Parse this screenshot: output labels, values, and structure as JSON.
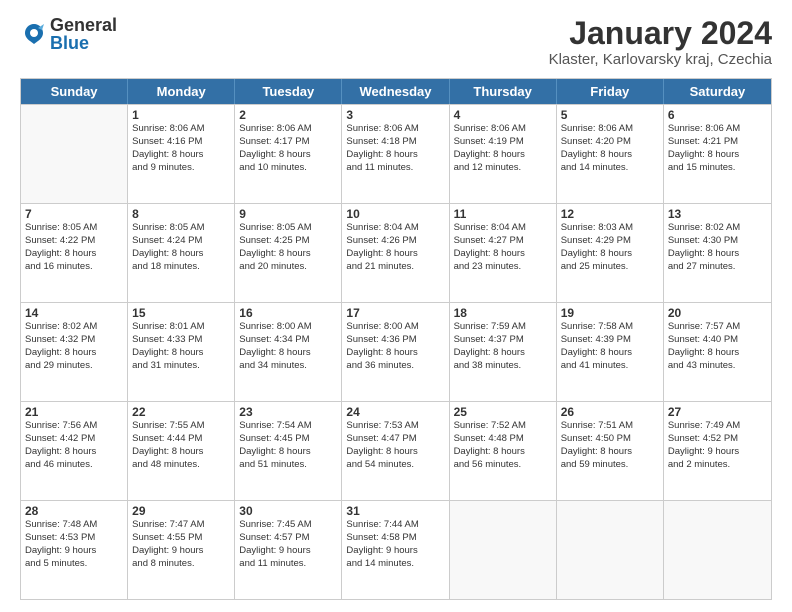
{
  "logo": {
    "general": "General",
    "blue": "Blue"
  },
  "header": {
    "month": "January 2024",
    "location": "Klaster, Karlovarsky kraj, Czechia"
  },
  "weekdays": [
    "Sunday",
    "Monday",
    "Tuesday",
    "Wednesday",
    "Thursday",
    "Friday",
    "Saturday"
  ],
  "weeks": [
    [
      {
        "day": "",
        "info": ""
      },
      {
        "day": "1",
        "info": "Sunrise: 8:06 AM\nSunset: 4:16 PM\nDaylight: 8 hours\nand 9 minutes."
      },
      {
        "day": "2",
        "info": "Sunrise: 8:06 AM\nSunset: 4:17 PM\nDaylight: 8 hours\nand 10 minutes."
      },
      {
        "day": "3",
        "info": "Sunrise: 8:06 AM\nSunset: 4:18 PM\nDaylight: 8 hours\nand 11 minutes."
      },
      {
        "day": "4",
        "info": "Sunrise: 8:06 AM\nSunset: 4:19 PM\nDaylight: 8 hours\nand 12 minutes."
      },
      {
        "day": "5",
        "info": "Sunrise: 8:06 AM\nSunset: 4:20 PM\nDaylight: 8 hours\nand 14 minutes."
      },
      {
        "day": "6",
        "info": "Sunrise: 8:06 AM\nSunset: 4:21 PM\nDaylight: 8 hours\nand 15 minutes."
      }
    ],
    [
      {
        "day": "7",
        "info": "Sunrise: 8:05 AM\nSunset: 4:22 PM\nDaylight: 8 hours\nand 16 minutes."
      },
      {
        "day": "8",
        "info": "Sunrise: 8:05 AM\nSunset: 4:24 PM\nDaylight: 8 hours\nand 18 minutes."
      },
      {
        "day": "9",
        "info": "Sunrise: 8:05 AM\nSunset: 4:25 PM\nDaylight: 8 hours\nand 20 minutes."
      },
      {
        "day": "10",
        "info": "Sunrise: 8:04 AM\nSunset: 4:26 PM\nDaylight: 8 hours\nand 21 minutes."
      },
      {
        "day": "11",
        "info": "Sunrise: 8:04 AM\nSunset: 4:27 PM\nDaylight: 8 hours\nand 23 minutes."
      },
      {
        "day": "12",
        "info": "Sunrise: 8:03 AM\nSunset: 4:29 PM\nDaylight: 8 hours\nand 25 minutes."
      },
      {
        "day": "13",
        "info": "Sunrise: 8:02 AM\nSunset: 4:30 PM\nDaylight: 8 hours\nand 27 minutes."
      }
    ],
    [
      {
        "day": "14",
        "info": "Sunrise: 8:02 AM\nSunset: 4:32 PM\nDaylight: 8 hours\nand 29 minutes."
      },
      {
        "day": "15",
        "info": "Sunrise: 8:01 AM\nSunset: 4:33 PM\nDaylight: 8 hours\nand 31 minutes."
      },
      {
        "day": "16",
        "info": "Sunrise: 8:00 AM\nSunset: 4:34 PM\nDaylight: 8 hours\nand 34 minutes."
      },
      {
        "day": "17",
        "info": "Sunrise: 8:00 AM\nSunset: 4:36 PM\nDaylight: 8 hours\nand 36 minutes."
      },
      {
        "day": "18",
        "info": "Sunrise: 7:59 AM\nSunset: 4:37 PM\nDaylight: 8 hours\nand 38 minutes."
      },
      {
        "day": "19",
        "info": "Sunrise: 7:58 AM\nSunset: 4:39 PM\nDaylight: 8 hours\nand 41 minutes."
      },
      {
        "day": "20",
        "info": "Sunrise: 7:57 AM\nSunset: 4:40 PM\nDaylight: 8 hours\nand 43 minutes."
      }
    ],
    [
      {
        "day": "21",
        "info": "Sunrise: 7:56 AM\nSunset: 4:42 PM\nDaylight: 8 hours\nand 46 minutes."
      },
      {
        "day": "22",
        "info": "Sunrise: 7:55 AM\nSunset: 4:44 PM\nDaylight: 8 hours\nand 48 minutes."
      },
      {
        "day": "23",
        "info": "Sunrise: 7:54 AM\nSunset: 4:45 PM\nDaylight: 8 hours\nand 51 minutes."
      },
      {
        "day": "24",
        "info": "Sunrise: 7:53 AM\nSunset: 4:47 PM\nDaylight: 8 hours\nand 54 minutes."
      },
      {
        "day": "25",
        "info": "Sunrise: 7:52 AM\nSunset: 4:48 PM\nDaylight: 8 hours\nand 56 minutes."
      },
      {
        "day": "26",
        "info": "Sunrise: 7:51 AM\nSunset: 4:50 PM\nDaylight: 8 hours\nand 59 minutes."
      },
      {
        "day": "27",
        "info": "Sunrise: 7:49 AM\nSunset: 4:52 PM\nDaylight: 9 hours\nand 2 minutes."
      }
    ],
    [
      {
        "day": "28",
        "info": "Sunrise: 7:48 AM\nSunset: 4:53 PM\nDaylight: 9 hours\nand 5 minutes."
      },
      {
        "day": "29",
        "info": "Sunrise: 7:47 AM\nSunset: 4:55 PM\nDaylight: 9 hours\nand 8 minutes."
      },
      {
        "day": "30",
        "info": "Sunrise: 7:45 AM\nSunset: 4:57 PM\nDaylight: 9 hours\nand 11 minutes."
      },
      {
        "day": "31",
        "info": "Sunrise: 7:44 AM\nSunset: 4:58 PM\nDaylight: 9 hours\nand 14 minutes."
      },
      {
        "day": "",
        "info": ""
      },
      {
        "day": "",
        "info": ""
      },
      {
        "day": "",
        "info": ""
      }
    ]
  ]
}
